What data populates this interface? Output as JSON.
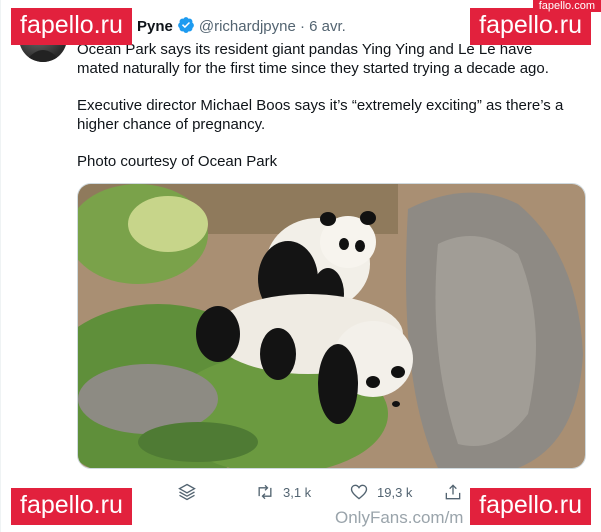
{
  "tweet": {
    "author_name": "Richard Pyne",
    "handle": "@richardjpyne",
    "separator": "·",
    "date": "6 avr.",
    "paragraphs": [
      "Ocean Park says its resident giant pandas Ying Ying and Le Le have mated naturally for the first time since they started trying a decade ago.",
      "Executive director Michael Boos says it’s “extremely exciting” as there’s a higher chance of pregnancy.",
      "Photo courtesy of Ocean Park"
    ]
  },
  "actions": {
    "reply_icon": "layers-icon",
    "retweets": "3,1 k",
    "likes": "19,3 k"
  },
  "watermarks": {
    "label": "fapello.ru",
    "corner_label": "fapello.com",
    "footer": "OnlyFans.com/m"
  },
  "colors": {
    "watermark": "#e2213d",
    "verified": "#1d9bf0",
    "secondary_text": "#536471"
  }
}
